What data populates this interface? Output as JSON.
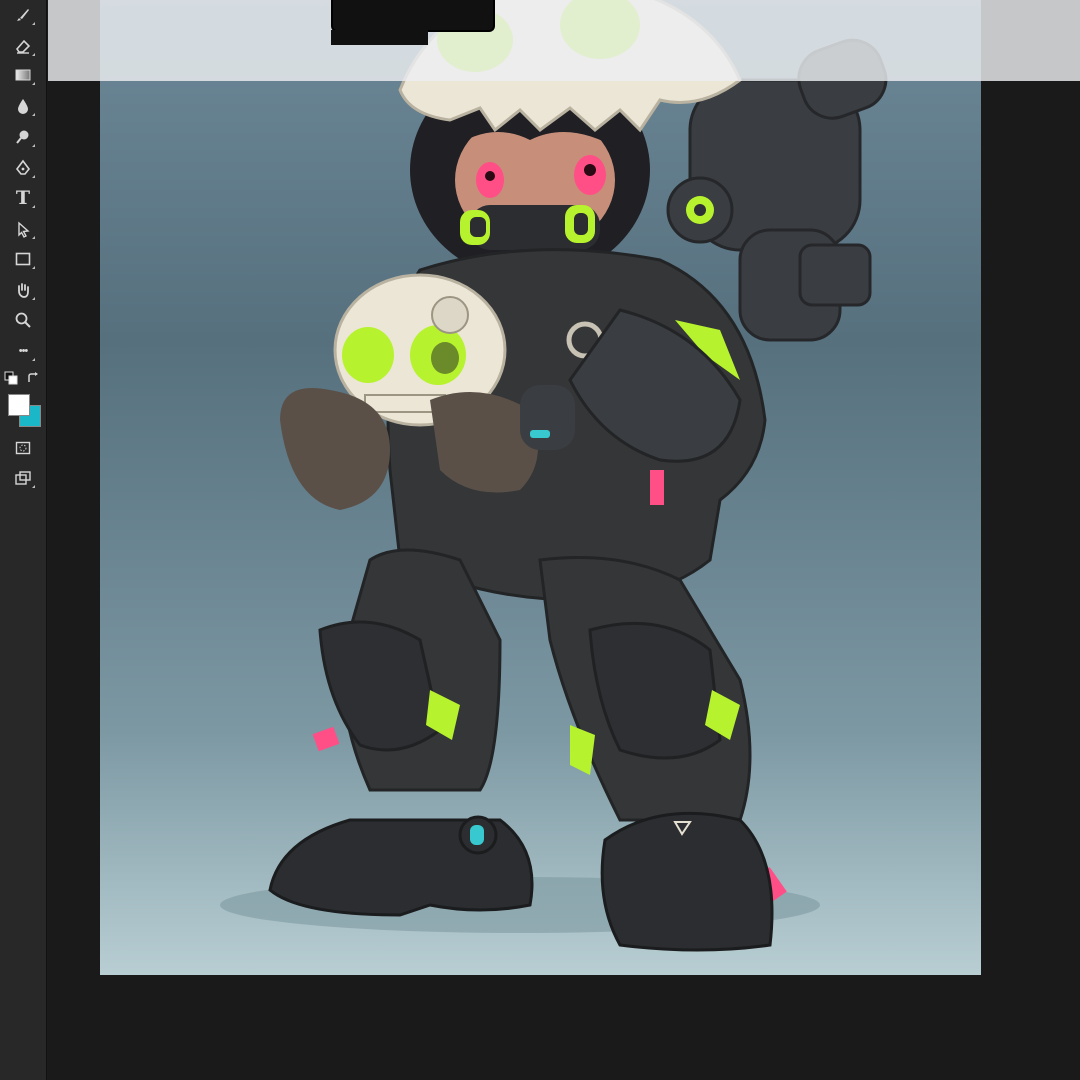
{
  "app": {
    "theme": {
      "panel": "#282828",
      "workspace": "#1a1a1a",
      "icon": "#d6d6d6"
    }
  },
  "toolbar": {
    "tools": [
      {
        "id": "brush",
        "icon": "brush-icon"
      },
      {
        "id": "eraser",
        "icon": "eraser-icon"
      },
      {
        "id": "gradient",
        "icon": "gradient-icon"
      },
      {
        "id": "blur",
        "icon": "blur-drop-icon"
      },
      {
        "id": "dodge",
        "icon": "dodge-icon"
      },
      {
        "id": "pen",
        "icon": "pen-icon"
      },
      {
        "id": "type",
        "icon": "type-icon",
        "glyph": "T"
      },
      {
        "id": "path-select",
        "icon": "path-select-icon"
      },
      {
        "id": "rectangle",
        "icon": "rectangle-icon"
      },
      {
        "id": "hand",
        "icon": "hand-icon"
      },
      {
        "id": "zoom",
        "icon": "zoom-icon"
      },
      {
        "id": "more",
        "icon": "more-tools-icon",
        "glyph": "•••"
      }
    ],
    "colors": {
      "foreground": "#ffffff",
      "background": "#19b7c8"
    }
  },
  "canvas": {
    "background_gradient": [
      "#6d8898",
      "#56707e",
      "#7c98a3",
      "#b8ced3"
    ],
    "accent_colors": {
      "neon_green": "#b6f22d",
      "pink": "#ff4f86",
      "cyan": "#38c8d0",
      "suit": "#343638",
      "bone": "#ece6d6"
    }
  }
}
